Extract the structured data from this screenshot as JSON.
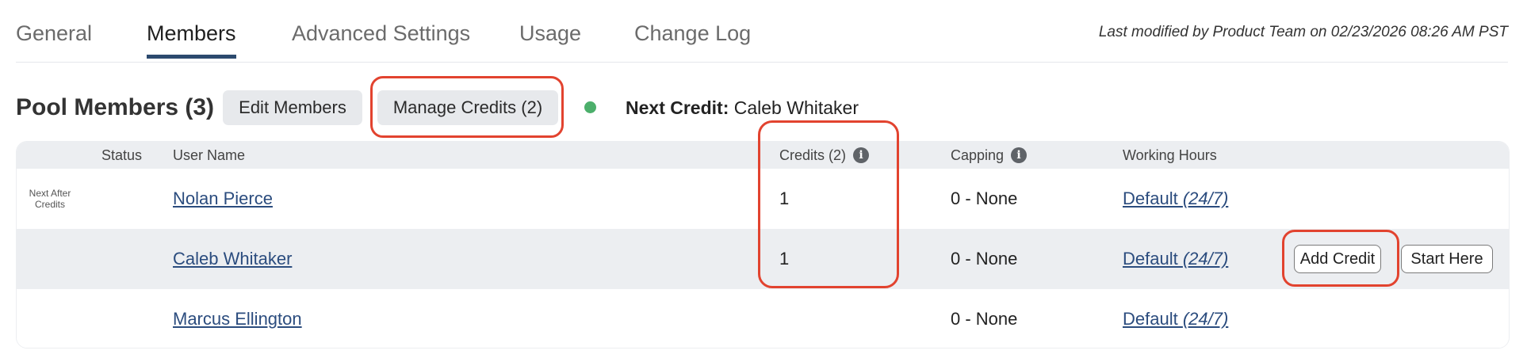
{
  "tabs": [
    {
      "label": "General"
    },
    {
      "label": "Members",
      "active": true
    },
    {
      "label": "Advanced Settings"
    },
    {
      "label": "Usage"
    },
    {
      "label": "Change Log"
    }
  ],
  "last_modified": "Last modified by Product Team on 02/23/2026 08:26 AM PST",
  "header": {
    "title": "Pool Members (3)",
    "edit_members_label": "Edit Members",
    "manage_credits_label": "Manage Credits (2)",
    "next_credit_label": "Next Credit:",
    "next_credit_value": "Caleb Whitaker"
  },
  "table": {
    "columns": {
      "status": "Status",
      "user_name": "User Name",
      "credits": "Credits (2)",
      "capping": "Capping",
      "working_hours": "Working Hours"
    },
    "rows": [
      {
        "status_note": "Next After Credits",
        "user": "Nolan Pierce",
        "credits": "1",
        "capping": "0 - None",
        "hours_prefix": "Default ",
        "hours_suffix": "(24/7)"
      },
      {
        "status_note": "",
        "user": "Caleb Whitaker",
        "credits": "1",
        "capping": "0 - None",
        "hours_prefix": "Default ",
        "hours_suffix": "(24/7)",
        "add_credit_label": "Add Credit",
        "start_here_label": "Start Here"
      },
      {
        "status_note": "",
        "user": "Marcus Ellington",
        "credits": "",
        "capping": "0 - None",
        "hours_prefix": "Default ",
        "hours_suffix": "(24/7)"
      }
    ]
  },
  "icons": {
    "info_glyph": "i",
    "status_dot_color": "#4caf6b"
  },
  "colors": {
    "highlight": "#e2432f",
    "link": "#2b4c7e",
    "tab_underline": "#2c4a6e"
  }
}
